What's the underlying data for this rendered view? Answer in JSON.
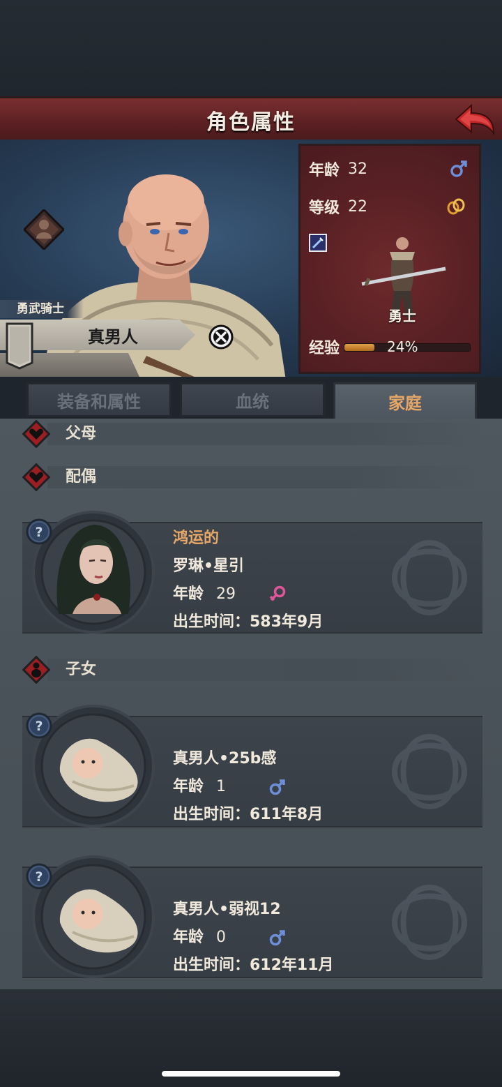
{
  "header": {
    "title": "角色属性"
  },
  "character": {
    "title_label": "勇武骑士",
    "name": "真男人",
    "age_label": "年龄",
    "age": "32",
    "level_label": "等级",
    "level": "22",
    "class_name": "勇士",
    "exp_label": "经验",
    "exp_text": "24%",
    "exp_fraction": 0.24
  },
  "tabs": [
    {
      "label": "装备和属性",
      "active": false
    },
    {
      "label": "血统",
      "active": false
    },
    {
      "label": "家庭",
      "active": true
    }
  ],
  "family": {
    "parents_label": "父母",
    "spouse_label": "配偶",
    "children_label": "子女",
    "spouse": {
      "trait": "鸿运的",
      "name": "罗琳•星引",
      "age_label": "年龄",
      "age": "29",
      "gender": "female",
      "birth": "出生时间：583年9月"
    },
    "children": [
      {
        "name": "真男人•25b感",
        "age_label": "年龄",
        "age": "1",
        "gender": "male",
        "birth": "出生时间：611年8月"
      },
      {
        "name": "真男人•弱视12",
        "age_label": "年龄",
        "age": "0",
        "gender": "male",
        "birth": "出生时间：612年11月"
      }
    ]
  },
  "colors": {
    "accent_orange": "#e7a867",
    "female_pink": "#e0559a",
    "male_blue": "#6e8fd8",
    "title_red": "#7a2f2f"
  }
}
